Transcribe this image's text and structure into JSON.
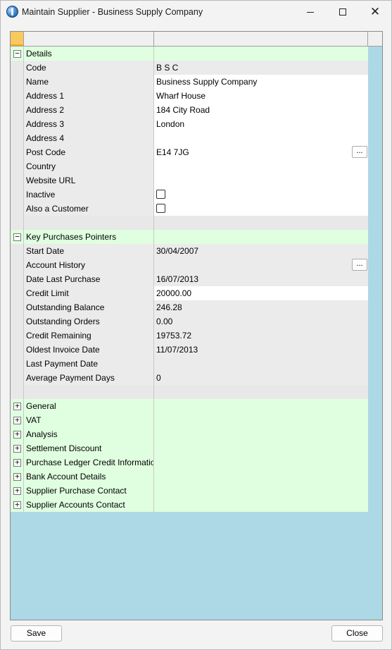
{
  "window": {
    "title": "Maintain Supplier - Business Supply Company",
    "icon": "app-globe-icon",
    "controls": {
      "minimize": "minimize-icon",
      "maximize": "maximize-icon",
      "close": "close-icon"
    }
  },
  "colors": {
    "grid_background": "#add8e6",
    "category_row": "#e0ffe0",
    "readonly_cell": "#ebebeb",
    "editable_cell": "#ffffff",
    "header_selected": "#f7c95e"
  },
  "sections": {
    "details": {
      "label": "Details",
      "expander": "−",
      "rows": {
        "code": {
          "label": "Code",
          "value": "B S C"
        },
        "name": {
          "label": "Name",
          "value": "Business Supply Company"
        },
        "address1": {
          "label": "Address 1",
          "value": "Wharf House"
        },
        "address2": {
          "label": "Address 2",
          "value": "184 City Road"
        },
        "address3": {
          "label": "Address 3",
          "value": "London"
        },
        "address4": {
          "label": "Address 4",
          "value": ""
        },
        "post_code": {
          "label": "Post Code",
          "value": "E14 7JG",
          "button": "..."
        },
        "country": {
          "label": "Country",
          "value": ""
        },
        "website": {
          "label": "Website URL",
          "value": ""
        },
        "inactive": {
          "label": "Inactive",
          "checked": false
        },
        "also_customer": {
          "label": "Also a Customer",
          "checked": false
        }
      }
    },
    "key_purchases": {
      "label": "Key Purchases Pointers",
      "expander": "−",
      "rows": {
        "start_date": {
          "label": "Start Date",
          "value": "30/04/2007"
        },
        "account_history": {
          "label": "Account History",
          "value": "",
          "button": "..."
        },
        "date_last_purchase": {
          "label": "Date Last Purchase",
          "value": "16/07/2013"
        },
        "credit_limit": {
          "label": "Credit Limit",
          "value": "20000.00"
        },
        "outstanding_balance": {
          "label": "Outstanding Balance",
          "value": "246.28"
        },
        "outstanding_orders": {
          "label": "Outstanding Orders",
          "value": "0.00"
        },
        "credit_remaining": {
          "label": "Credit Remaining",
          "value": "19753.72"
        },
        "oldest_invoice_date": {
          "label": "Oldest Invoice Date",
          "value": "11/07/2013"
        },
        "last_payment_date": {
          "label": "Last Payment Date",
          "value": ""
        },
        "average_payment_days": {
          "label": "Average Payment Days",
          "value": "0"
        }
      }
    },
    "collapsed": [
      {
        "label": "General",
        "expander": "+"
      },
      {
        "label": "VAT",
        "expander": "+"
      },
      {
        "label": "Analysis",
        "expander": "+"
      },
      {
        "label": "Settlement Discount",
        "expander": "+"
      },
      {
        "label": "Purchase Ledger Credit Information",
        "expander": "+"
      },
      {
        "label": "Bank Account Details",
        "expander": "+"
      },
      {
        "label": "Supplier Purchase Contact",
        "expander": "+"
      },
      {
        "label": "Supplier Accounts Contact",
        "expander": "+"
      }
    ]
  },
  "buttons": {
    "save": "Save",
    "close": "Close"
  }
}
